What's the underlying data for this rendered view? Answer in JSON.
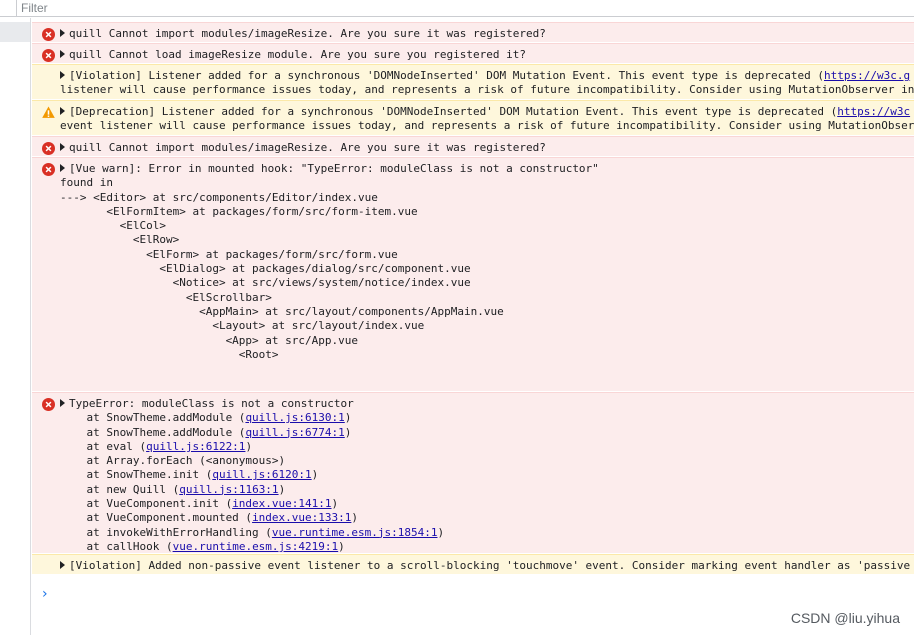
{
  "filter": {
    "placeholder": "Filter"
  },
  "colors": {
    "error_bg": "#fcecec",
    "warning_bg": "#fef7dc",
    "error_icon": "#d93025",
    "warning_icon": "#f29900",
    "link": "#1a0dab",
    "prompt": "#1a73e8"
  },
  "messages": [
    {
      "type": "error",
      "icon": "error-icon",
      "expandable": true,
      "lines": [
        "quill Cannot import modules/imageResize. Are you sure it was registered?"
      ]
    },
    {
      "type": "error",
      "icon": "error-icon",
      "expandable": true,
      "lines": [
        "quill Cannot load imageResize module. Are you sure you registered it?"
      ]
    },
    {
      "type": "violation",
      "icon": "",
      "expandable": true,
      "lines": [
        "[Violation] Listener added for a synchronous 'DOMNodeInserted' DOM Mutation Event. This event type is deprecated (",
        "listener will cause performance issues today, and represents a risk of future incompatibility. Consider using MutationObserver ins"
      ],
      "link": "https://w3c.g"
    },
    {
      "type": "warning",
      "icon": "warning-icon",
      "expandable": true,
      "lines": [
        "[Deprecation] Listener added for a synchronous 'DOMNodeInserted' DOM Mutation Event. This event type is deprecated (",
        "event listener will cause performance issues today, and represents a risk of future incompatibility. Consider using MutationObserv"
      ],
      "link": "https://w3c"
    },
    {
      "type": "error",
      "icon": "error-icon",
      "expandable": true,
      "lines": [
        "quill Cannot import modules/imageResize. Are you sure it was registered?"
      ]
    },
    {
      "type": "error",
      "icon": "error-icon",
      "expandable": true,
      "lines": [
        "[Vue warn]: Error in mounted hook: \"TypeError: moduleClass is not a constructor\"",
        "",
        "found in",
        "",
        "---> <Editor> at src/components/Editor/index.vue",
        "       <ElFormItem> at packages/form/src/form-item.vue",
        "         <ElCol>",
        "           <ElRow>",
        "             <ElForm> at packages/form/src/form.vue",
        "               <ElDialog> at packages/dialog/src/component.vue",
        "                 <Notice> at src/views/system/notice/index.vue",
        "                   <ElScrollbar>",
        "                     <AppMain> at src/layout/components/AppMain.vue",
        "                       <Layout> at src/layout/index.vue",
        "                         <App> at src/App.vue",
        "                           <Root>"
      ]
    },
    {
      "type": "error",
      "icon": "error-icon",
      "expandable": true,
      "lines": [
        "TypeError: moduleClass is not a constructor"
      ],
      "stack": [
        {
          "text": "    at SnowTheme.addModule (",
          "link": "quill.js:6130:1",
          "end": ")"
        },
        {
          "text": "    at SnowTheme.addModule (",
          "link": "quill.js:6774:1",
          "end": ")"
        },
        {
          "text": "    at eval (",
          "link": "quill.js:6122:1",
          "end": ")"
        },
        {
          "text": "    at Array.forEach (<anonymous>)",
          "link": "",
          "end": ""
        },
        {
          "text": "    at SnowTheme.init (",
          "link": "quill.js:6120:1",
          "end": ")"
        },
        {
          "text": "    at new Quill (",
          "link": "quill.js:1163:1",
          "end": ")"
        },
        {
          "text": "    at VueComponent.init (",
          "link": "index.vue:141:1",
          "end": ")"
        },
        {
          "text": "    at VueComponent.mounted (",
          "link": "index.vue:133:1",
          "end": ")"
        },
        {
          "text": "    at invokeWithErrorHandling (",
          "link": "vue.runtime.esm.js:1854:1",
          "end": ")"
        },
        {
          "text": "    at callHook (",
          "link": "vue.runtime.esm.js:4219:1",
          "end": ")"
        }
      ]
    },
    {
      "type": "violation",
      "icon": "",
      "expandable": true,
      "lines": [
        "[Violation] Added non-passive event listener to a scroll-blocking 'touchmove' event. Consider marking event handler as 'passive"
      ]
    }
  ],
  "prompt": "›",
  "watermark": "CSDN @liu.yihua"
}
